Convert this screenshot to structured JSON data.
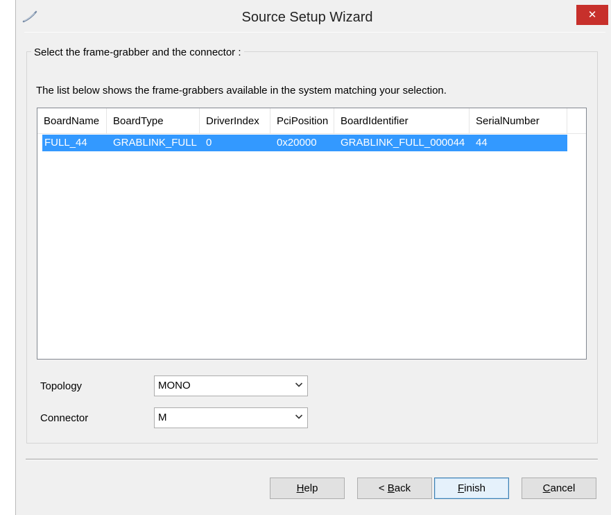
{
  "window": {
    "title": "Source Setup Wizard",
    "close_glyph": "✕",
    "app_icon": "wizard-wand-icon"
  },
  "group": {
    "title": "Select the frame-grabber and the connector :",
    "description": "The list below shows the frame-grabbers available in the system matching your selection."
  },
  "list": {
    "columns": [
      "BoardName",
      "BoardType",
      "DriverIndex",
      "PciPosition",
      "BoardIdentifier",
      "SerialNumber"
    ],
    "rows": [
      [
        "FULL_44",
        "GRABLINK_FULL",
        "0",
        "0x20000",
        "GRABLINK_FULL_000044",
        "44"
      ]
    ],
    "selected_row": 0
  },
  "fields": {
    "topology": {
      "label": "Topology",
      "value": "MONO"
    },
    "connector": {
      "label": "Connector",
      "value": "M"
    }
  },
  "buttons": {
    "help": {
      "pre": "",
      "mnemonic": "H",
      "post": "elp"
    },
    "back": {
      "pre": "< ",
      "mnemonic": "B",
      "post": "ack"
    },
    "finish": {
      "pre": "",
      "mnemonic": "F",
      "post": "inish"
    },
    "cancel": {
      "pre": "",
      "mnemonic": "C",
      "post": "ancel"
    }
  },
  "colors": {
    "close_button": "#c7302b",
    "selection": "#3399ff",
    "window_bg": "#f0f0f0"
  }
}
